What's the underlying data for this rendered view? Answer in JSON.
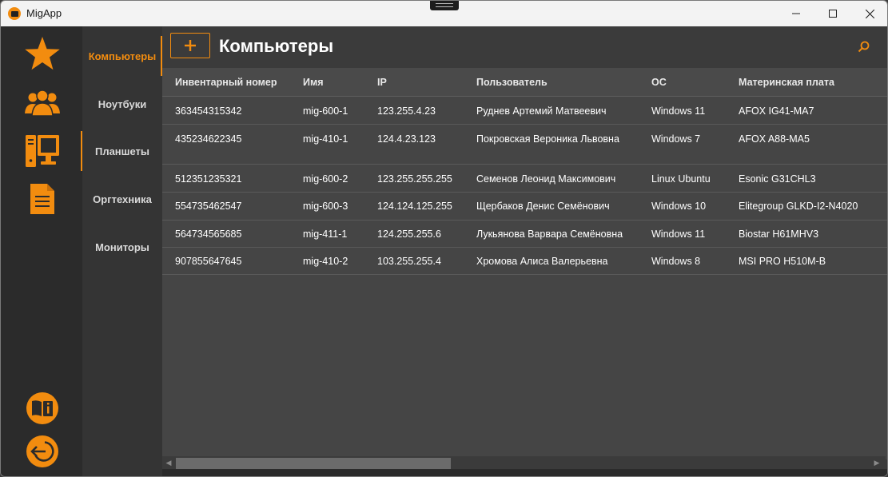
{
  "window": {
    "title": "MigApp"
  },
  "rail": {
    "items": [
      {
        "name": "favorites",
        "icon": "star-icon"
      },
      {
        "name": "users",
        "icon": "users-icon"
      },
      {
        "name": "computers",
        "icon": "computer-icon"
      },
      {
        "name": "documents",
        "icon": "document-icon"
      }
    ],
    "bottom": [
      {
        "name": "info",
        "icon": "book-info-icon"
      },
      {
        "name": "logout",
        "icon": "logout-icon"
      }
    ]
  },
  "subnav": {
    "items": [
      {
        "label": "Компьютеры",
        "active": true
      },
      {
        "label": "Ноутбуки",
        "active": false
      },
      {
        "label": "Планшеты",
        "active": false
      },
      {
        "label": "Оргтехника",
        "active": false
      },
      {
        "label": "Мониторы",
        "active": false
      }
    ]
  },
  "main": {
    "add_label": "+",
    "title": "Компьютеры",
    "search_icon": "search-icon"
  },
  "table": {
    "columns": [
      "Инвентарный номер",
      "Имя",
      "IP",
      "Пользователь",
      "ОС",
      "Материнская плата"
    ],
    "rows": [
      [
        "363454315342",
        "mig-600-1",
        "123.255.4.23",
        "Руднев Артемий Матвеевич",
        "Windows 11",
        "AFOX IG41-MA7"
      ],
      [
        "435234622345",
        "mig-410-1",
        "124.4.23.123",
        "Покровская Вероника Львовна",
        "Windows 7",
        "AFOX A88-MA5"
      ],
      [
        "512351235321",
        "mig-600-2",
        "123.255.255.255",
        "Семенов Леонид Максимович",
        "Linux Ubuntu",
        "Esonic G31CHL3"
      ],
      [
        "554735462547",
        "mig-600-3",
        "124.124.125.255",
        "Щербаков Денис Семёнович",
        "Windows 10",
        "Elitegroup GLKD-I2-N4020"
      ],
      [
        "564734565685",
        "mig-411-1",
        "124.255.255.6",
        "Лукьянова Варвара Семёновна",
        "Windows 11",
        "Biostar H61MHV3"
      ],
      [
        "907855647645",
        "mig-410-2",
        "103.255.255.4",
        "Хромова Алиса Валерьевна",
        "Windows 8",
        "MSI PRO H510M-B"
      ]
    ]
  },
  "colors": {
    "accent": "#f28c0f",
    "rail_bg": "#2b2b2b",
    "subnav_bg": "#343434",
    "grid_bg": "#454545"
  }
}
